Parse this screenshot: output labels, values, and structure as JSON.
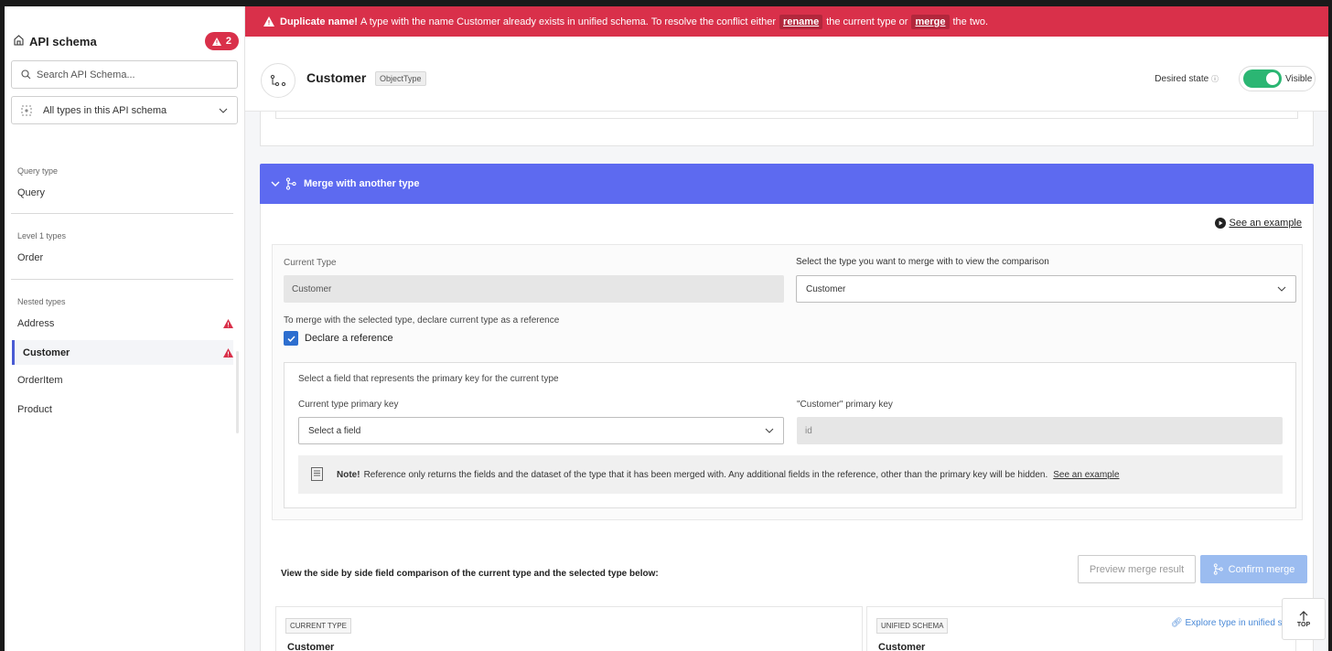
{
  "sidebar": {
    "title": "API schema",
    "error_count": "2",
    "search_placeholder": "Search API Schema...",
    "filter_label": "All types in this API schema",
    "sections": {
      "query": {
        "label": "Query type",
        "items": [
          "Query"
        ]
      },
      "level1": {
        "label": "Level 1 types",
        "items": [
          "Order"
        ]
      },
      "nested": {
        "label": "Nested types",
        "items": [
          "Address",
          "Customer",
          "OrderItem",
          "Product"
        ]
      }
    }
  },
  "alert": {
    "title": "Duplicate name!",
    "message_a": "A type with the name Customer already exists in unified schema. To resolve the conflict either",
    "rename": "rename",
    "message_b": "the current type or",
    "merge": "merge",
    "message_c": "the two."
  },
  "header": {
    "type_name": "Customer",
    "type_tag": "ObjectType",
    "desired_state_label": "Desired state",
    "toggle_label": "Visible",
    "toggle_on": true
  },
  "merge": {
    "section_title": "Merge with another type",
    "see_example": "See an example",
    "current_type_label": "Current Type",
    "current_type_value": "Customer",
    "select_label": "Select the type you want to merge with to view the comparison",
    "select_value": "Customer",
    "reference_hint": "To merge with the selected type, declare current type as a reference",
    "declare_reference": "Declare a reference",
    "declare_checked": true,
    "pk_prompt": "Select a field that represents the primary key for the current type",
    "current_pk_label": "Current type primary key",
    "current_pk_placeholder": "Select a field",
    "other_pk_label": "\"Customer\" primary key",
    "other_pk_value": "id",
    "note_bold": "Note!",
    "note_text": "Reference only returns the fields and the dataset of the type that it has been merged with. Any additional fields in the reference, other than the primary key will be hidden.",
    "note_link": "See an example"
  },
  "comparison": {
    "prompt": "View the side by side field comparison of the current type and the selected type below:",
    "preview_button": "Preview merge result",
    "confirm_button": "Confirm merge",
    "left_tag": "CURRENT TYPE",
    "left_name": "Customer",
    "right_tag": "UNIFIED SCHEMA",
    "right_name": "Customer",
    "explore_link": "Explore type in unified sche"
  },
  "top_button": "TOP",
  "colors": {
    "alert": "#d9304a",
    "merge_bar": "#5d6af0",
    "toggle": "#2bb673",
    "checkbox": "#2d6ecf",
    "confirm": "#9bbcf0"
  }
}
